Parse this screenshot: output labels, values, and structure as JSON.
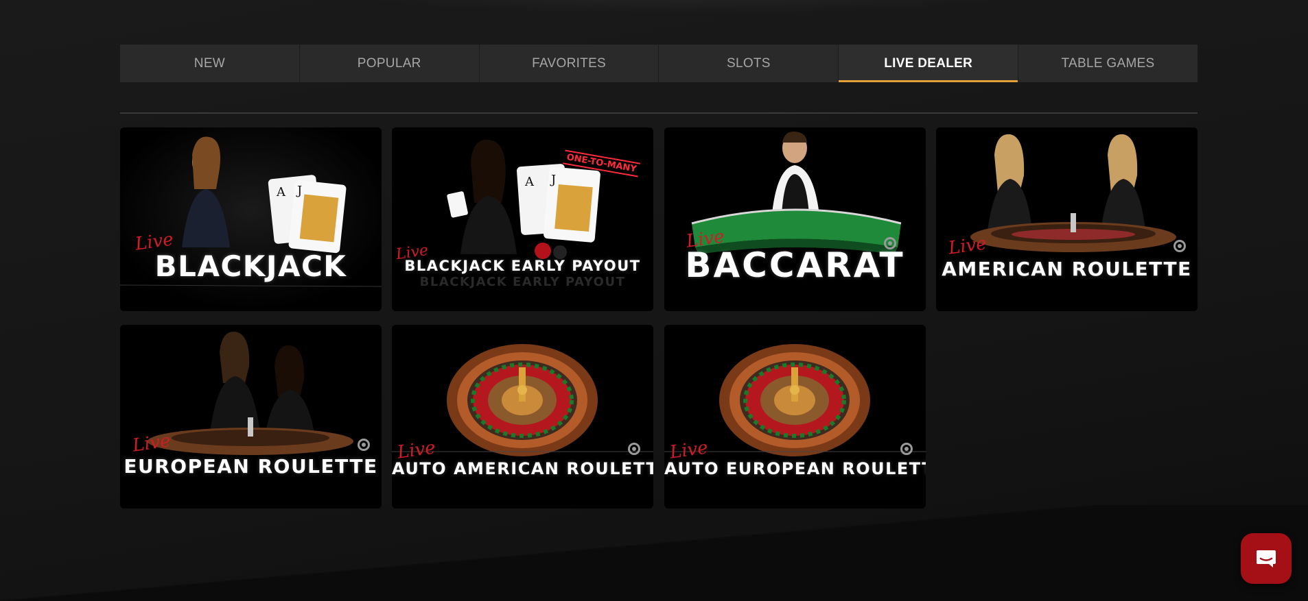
{
  "tabs": [
    {
      "label": "NEW",
      "active": false
    },
    {
      "label": "POPULAR",
      "active": false
    },
    {
      "label": "FAVORITES",
      "active": false
    },
    {
      "label": "SLOTS",
      "active": false
    },
    {
      "label": "LIVE DEALER",
      "active": true
    },
    {
      "label": "TABLE GAMES",
      "active": false
    }
  ],
  "games": [
    {
      "live": "Live",
      "title": "BLACKJACK",
      "art": "dealer-with-cards"
    },
    {
      "live": "Live",
      "title": "BLACKJACK EARLY PAYOUT",
      "badge": "ONE-TO-MANY",
      "reflection": "BLACKJACK EARLY PAYOUT",
      "art": "dealer-with-cards"
    },
    {
      "live": "Live",
      "title": "BACCARAT",
      "art": "dealer-at-table"
    },
    {
      "live": "Live",
      "title": "AMERICAN ROULETTE",
      "art": "two-dealers-roulette"
    },
    {
      "live": "Live",
      "title": "EUROPEAN ROULETTE",
      "art": "two-dealers-roulette"
    },
    {
      "live": "Live",
      "title": "AUTO AMERICAN ROULETTE",
      "art": "roulette-wheel"
    },
    {
      "live": "Live",
      "title": "AUTO EUROPEAN ROULETTE",
      "art": "roulette-wheel"
    }
  ],
  "chat": {
    "icon": "chat-icon"
  },
  "colors": {
    "background": "#141414",
    "tab_bg": "#2a2a2a",
    "tab_active_underline": "#e4a13a",
    "live_red": "#d11b27",
    "chat_button": "#a50f16"
  }
}
